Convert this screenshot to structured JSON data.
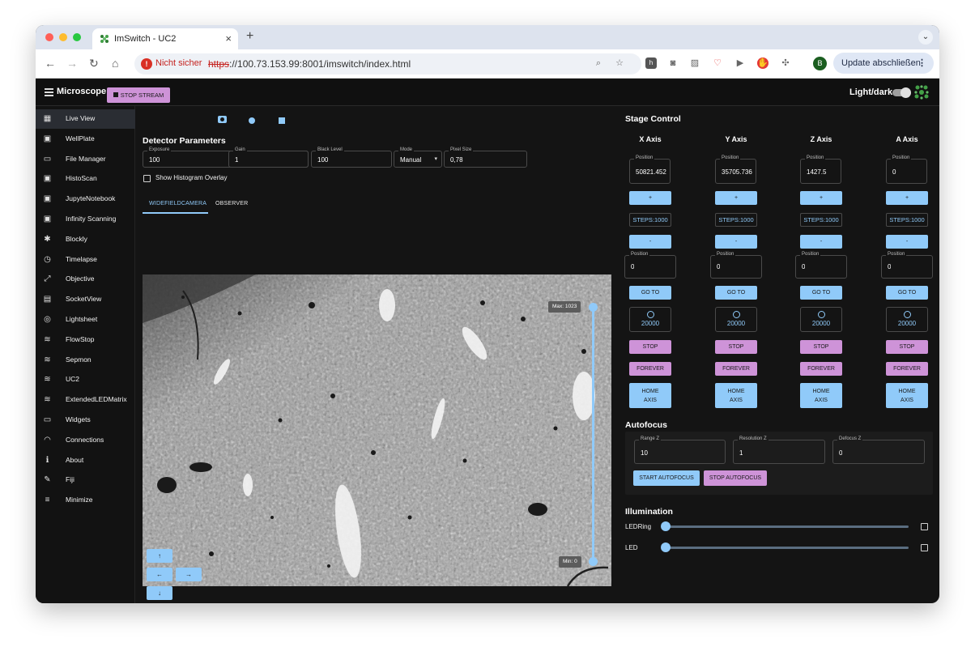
{
  "browser": {
    "tab_title": "ImSwitch - UC2",
    "new_tab": "+",
    "close": "×",
    "security_label": "Nicht sicher",
    "url_scheme": "https",
    "url_rest": "://100.73.153.99:8001/imswitch/index.html",
    "profile_initial": "B",
    "update_label": "Update abschließen",
    "menu_dots": "⋮"
  },
  "app": {
    "title": "Microscope Control",
    "theme_toggle_label": "Light/dark"
  },
  "sidebar": {
    "items": [
      {
        "label": "Live View",
        "icon": "dashboard-icon",
        "glyph": "▦",
        "active": true
      },
      {
        "label": "WellPlate",
        "icon": "grid-icon",
        "glyph": "▣"
      },
      {
        "label": "File Manager",
        "icon": "devices-icon",
        "glyph": "▭"
      },
      {
        "label": "HistoScan",
        "icon": "grid-icon",
        "glyph": "▣"
      },
      {
        "label": "JupyteNotebook",
        "icon": "grid-icon",
        "glyph": "▣"
      },
      {
        "label": "Infinity Scanning",
        "icon": "grid-icon",
        "glyph": "▣"
      },
      {
        "label": "Blockly",
        "icon": "gear-icon",
        "glyph": "✱"
      },
      {
        "label": "Timelapse",
        "icon": "clock-icon",
        "glyph": "◷"
      },
      {
        "label": "Objective",
        "icon": "zoom-out-map-icon",
        "glyph": "⤢"
      },
      {
        "label": "SocketView",
        "icon": "chat-icon",
        "glyph": "▤"
      },
      {
        "label": "Lightsheet",
        "icon": "3d-rotation-icon",
        "glyph": "◎"
      },
      {
        "label": "FlowStop",
        "icon": "air-icon",
        "glyph": "≋"
      },
      {
        "label": "Sepmon",
        "icon": "air-icon",
        "glyph": "≋"
      },
      {
        "label": "UC2",
        "icon": "air-icon",
        "glyph": "≋"
      },
      {
        "label": "ExtendedLEDMatrix",
        "icon": "air-icon",
        "glyph": "≋"
      },
      {
        "label": "Widgets",
        "icon": "devices-icon",
        "glyph": "▭"
      },
      {
        "label": "Connections",
        "icon": "wifi-icon",
        "glyph": "◠"
      },
      {
        "label": "About",
        "icon": "info-icon",
        "glyph": "ℹ"
      },
      {
        "label": "Fiji",
        "icon": "build-icon",
        "glyph": "✎"
      },
      {
        "label": "Minimize",
        "icon": "menu-icon",
        "glyph": "≡"
      }
    ]
  },
  "liveview": {
    "stop_stream_label": "STOP STREAM",
    "detector_title": "Detector Parameters",
    "fields": [
      {
        "label": "Exposure",
        "value": "100"
      },
      {
        "label": "Gain",
        "value": "1"
      },
      {
        "label": "Black Level",
        "value": "100"
      },
      {
        "label": "Mode",
        "value": "Manual"
      },
      {
        "label": "Pixel Size",
        "value": "0,78"
      }
    ],
    "histogram_label": "Show Histogram Overlay",
    "histogram_checked": false,
    "tabs": [
      "WIDEFIELDCAMERA",
      "OBSERVER"
    ],
    "active_tab": 0,
    "range_max_label": "Max: 1023",
    "range_min_label": "Min: 0",
    "arrows": {
      "up": "↑",
      "left": "←",
      "right": "→",
      "down": "↓"
    }
  },
  "stage": {
    "title": "Stage Control",
    "axes": [
      {
        "name": "X Axis",
        "position": "50821.452",
        "steps": "STEPS:1000",
        "goto": "0",
        "speed": "20000"
      },
      {
        "name": "Y Axis",
        "position": "35705.736",
        "steps": "STEPS:1000",
        "goto": "0",
        "speed": "20000"
      },
      {
        "name": "Z Axis",
        "position": "1427.5",
        "steps": "STEPS:1000",
        "goto": "0",
        "speed": "20000"
      },
      {
        "name": "A Axis",
        "position": "0",
        "steps": "STEPS:1000",
        "goto": "0",
        "speed": "20000"
      }
    ],
    "position_label": "Position",
    "plus_label": "+",
    "minus_label": "-",
    "goto_label": "GO TO",
    "stop_label": "STOP",
    "forever_label": "FOREVER",
    "home_label_1": "HOME",
    "home_label_2": "AXIS"
  },
  "autofocus": {
    "title": "Autofocus",
    "fields": [
      {
        "label": "Range Z",
        "value": "10"
      },
      {
        "label": "Resolution Z",
        "value": "1"
      },
      {
        "label": "Defocus Z",
        "value": "0"
      }
    ],
    "start_label": "START AUTOFOCUS",
    "stop_label": "STOP AUTOFOCUS"
  },
  "illumination": {
    "title": "Illumination",
    "channels": [
      {
        "label": "LEDRing",
        "level": 0,
        "enabled": false
      },
      {
        "label": "LED",
        "level": 0,
        "enabled": false
      }
    ]
  },
  "colors": {
    "accent_blue": "#90caf9",
    "accent_purple": "#ce93d8",
    "background": "#141414"
  }
}
